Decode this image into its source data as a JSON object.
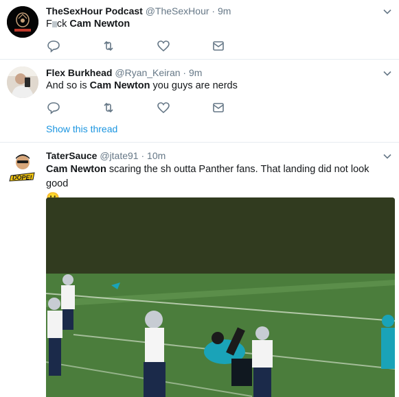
{
  "tweets": [
    {
      "name": "TheSexHour Podcast",
      "handle": "@TheSexHour",
      "dot": "·",
      "time": "9m",
      "text_pre": "F",
      "text_obscured": "  ",
      "text_mid": "ck ",
      "text_bold": "Cam Newton",
      "text_post": ""
    },
    {
      "name": "Flex Burkhead",
      "handle": "@Ryan_Keiran",
      "dot": "·",
      "time": "9m",
      "text_pre": "And so is ",
      "text_bold": "Cam Newton",
      "text_post": " you guys are nerds",
      "show_thread": "Show this thread"
    },
    {
      "name": "TaterSauce",
      "handle": "@jtate91",
      "dot": "·",
      "time": "10m",
      "text_bold": "Cam Newton",
      "text_post": " scaring the sh   outta Panther fans. That landing did not look good",
      "emoji": "😬"
    }
  ],
  "icons": [
    "reply-icon",
    "retweet-icon",
    "like-icon",
    "message-icon",
    "chevron-down-icon"
  ],
  "colors": {
    "accent": "#1b95e0",
    "muted": "#657786",
    "divider": "#e6ecf0",
    "field": "#3f7a36"
  }
}
